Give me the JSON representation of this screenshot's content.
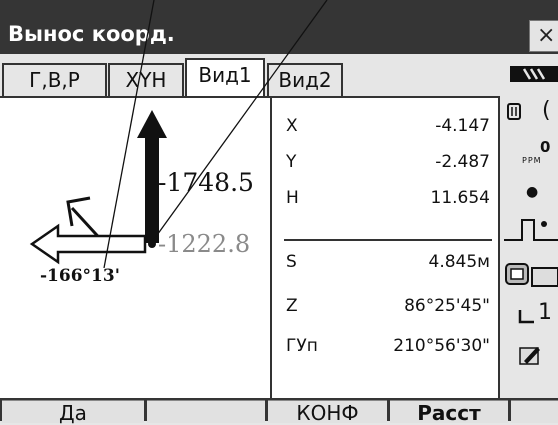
{
  "window": {
    "title": "Вынос коорд.",
    "close_label": "×"
  },
  "tabs": [
    {
      "label": "Г,В,Р"
    },
    {
      "label": "XYH"
    },
    {
      "label": "Вид1"
    },
    {
      "label": "Вид2"
    }
  ],
  "drawing": {
    "forward_distance": "-1748.5",
    "right_distance": "-1222.8",
    "angle": "-166°13'"
  },
  "readouts": [
    {
      "label": "X",
      "value": "-4.147"
    },
    {
      "label": "Y",
      "value": "-2.487"
    },
    {
      "label": "H",
      "value": "11.654"
    },
    {
      "label": "S",
      "value": "4.845м"
    },
    {
      "label": "Z",
      "value": "86°25'45\""
    },
    {
      "label": "ГУп",
      "value": "210°56'30\""
    }
  ],
  "sidebar": {
    "ppm_value": "0",
    "ppm_unit": "PPM",
    "prism_const": "1"
  },
  "softkeys": [
    {
      "label": "Да"
    },
    {
      "label": ""
    },
    {
      "label": "КОНФ"
    },
    {
      "label": "Расст"
    },
    {
      "label": ""
    }
  ]
}
